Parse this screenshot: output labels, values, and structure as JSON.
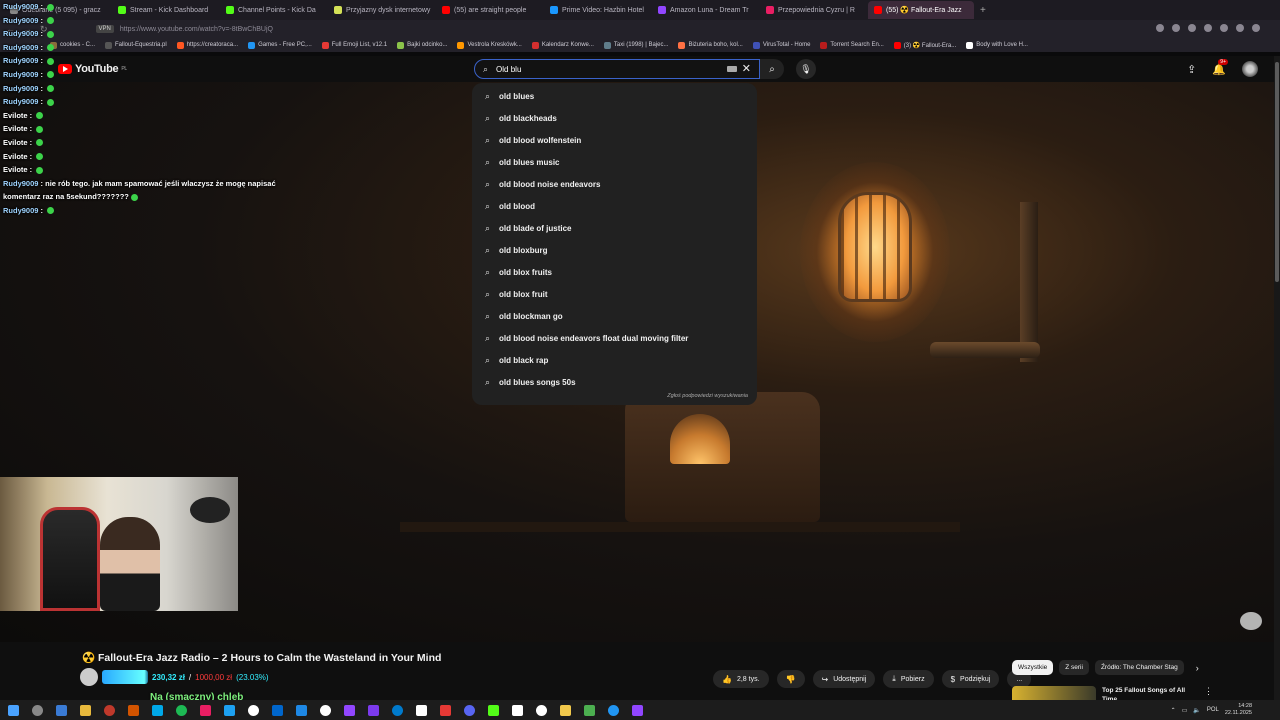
{
  "browser": {
    "tabs": [
      {
        "label": "Odebrane (5 095) - gracz",
        "color": "#888888"
      },
      {
        "label": "Stream - Kick Dashboard",
        "color": "#53fc18"
      },
      {
        "label": "Channel Points - Kick Da",
        "color": "#53fc18"
      },
      {
        "label": "Przyjazny dysk internetowy",
        "color": "#d4e157"
      },
      {
        "label": "(55) are straight people",
        "color": "#ff0000"
      },
      {
        "label": "Prime Video: Hazbin Hotel",
        "color": "#1a98ff"
      },
      {
        "label": "Amazon Luna - Dream Tr",
        "color": "#9146ff"
      },
      {
        "label": "Przepowiednia Cyzru | R",
        "color": "#e91e63"
      },
      {
        "label": "(55) ☢️ Fallout-Era Jazz",
        "color": "#ff0000"
      }
    ],
    "active_tab": 8,
    "url": "https://www.youtube.com/watch?v=-8tBwChBUjQ",
    "vpn_label": "VPN",
    "bookmarks": [
      {
        "label": "cookies - C...",
        "color": "#8a6d3b"
      },
      {
        "label": "Fallout-Equestria.pl",
        "color": "#555555"
      },
      {
        "label": "https://creatoraca...",
        "color": "#ff5722"
      },
      {
        "label": "Games - Free PC,...",
        "color": "#2196f3"
      },
      {
        "label": "Full Emoji List, v12.1",
        "color": "#e53935"
      },
      {
        "label": "Bajki odcinko...",
        "color": "#8bc34a"
      },
      {
        "label": "Vestrola Kreskówk...",
        "color": "#ff9800"
      },
      {
        "label": "Kalendarz Konwe...",
        "color": "#d32f2f"
      },
      {
        "label": "Taxi (1998) | Bajec...",
        "color": "#607d8b"
      },
      {
        "label": "Biżuteria boho, kol...",
        "color": "#ff7043"
      },
      {
        "label": "VirusTotal - Home",
        "color": "#3f51b5"
      },
      {
        "label": "Torrent Search En...",
        "color": "#b71c1c"
      },
      {
        "label": "(3) ☢️ Fallout-Era...",
        "color": "#ff0000"
      },
      {
        "label": "Body with Love H...",
        "color": "#ffffff"
      }
    ]
  },
  "youtube": {
    "logo_text": "YouTube",
    "logo_region": "PL",
    "search_value": "Old blu",
    "notification_count": "9+",
    "suggestions": [
      "old blues",
      "old blackheads",
      "old blood wolfenstein",
      "old blues music",
      "old blood noise endeavors",
      "old blood",
      "old blade of justice",
      "old bloxburg",
      "old blox fruits",
      "old blox fruit",
      "old blockman go",
      "old blood noise endeavors float dual moving filter",
      "old black rap",
      "old blues songs 50s"
    ],
    "report_label": "Zgłoś podpowiedzi wyszukiwania",
    "video_title": "☢️ Fallout-Era Jazz Radio – 2 Hours to Calm the Wasteland in Your Mind",
    "like_count": "2,8 tys.",
    "share_label": "Udostępnij",
    "download_label": "Pobierz",
    "thanks_label": "Podziękuj",
    "more_label": "...",
    "chips": [
      "Wszystkie",
      "Z serii",
      "Źródło: The Chamber Stag"
    ],
    "side_video_title": "Top 25 Fallout Songs of All Time"
  },
  "chat": [
    {
      "user": "Rudy9009",
      "msg": ""
    },
    {
      "user": "Rudy9009",
      "msg": ""
    },
    {
      "user": "Rudy9009",
      "msg": ""
    },
    {
      "user": "Rudy9009",
      "msg": ""
    },
    {
      "user": "Rudy9009",
      "msg": ""
    },
    {
      "user": "Rudy9009",
      "msg": ""
    },
    {
      "user": "Rudy9009",
      "msg": ""
    },
    {
      "user": "Rudy9009",
      "msg": ""
    },
    {
      "user": "Evilote",
      "msg": ""
    },
    {
      "user": "Evilote",
      "msg": ""
    },
    {
      "user": "Evilote",
      "msg": ""
    },
    {
      "user": "Evilote",
      "msg": ""
    },
    {
      "user": "Evilote",
      "msg": ""
    },
    {
      "user": "Rudy9009",
      "msg": "nie rób tego. jak mam spamować jeśli wlaczysz że mogę napisać komentarz raz na 5sekund???????"
    },
    {
      "user": "Rudy9009",
      "msg": ""
    }
  ],
  "donation": {
    "current": "230,32 zł",
    "separator": "/",
    "goal": "1000,00 zł",
    "percent": "(23.03%)",
    "progress": 0.2303
  },
  "overlay_text": "Na (smaczny) chleb",
  "taskbar": {
    "language": "POL",
    "time": "14:28",
    "date": "22.11.2025",
    "app_colors": [
      "#888888",
      "#3a7bd5",
      "#e8b93c",
      "#c0392b",
      "#d35400",
      "#00a8e8",
      "#1db954",
      "#e91e63",
      "#1da1f2",
      "#ffffff",
      "#0066cc",
      "#1e88e5",
      "#ffffff",
      "#9146ff",
      "#7c3aed",
      "#007acc",
      "#ffffff",
      "#e53935",
      "#5865f2",
      "#53fc18",
      "#ffffff",
      "#ffffff",
      "#f2c94c",
      "#4caf50",
      "#2196f3",
      "#9146ff"
    ]
  }
}
